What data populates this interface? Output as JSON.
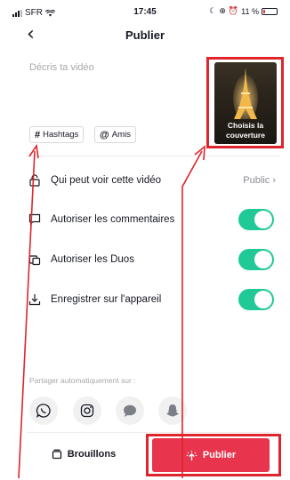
{
  "status_bar": {
    "carrier": "SFR",
    "time": "17:45",
    "battery": "11 %"
  },
  "header": {
    "title": "Publier"
  },
  "description": {
    "placeholder": "Décris ta vidéo"
  },
  "cover": {
    "label": "Choisis la couverture"
  },
  "chips": {
    "hashtags": "Hashtags",
    "friends": "Amis"
  },
  "settings": {
    "visibility": {
      "label": "Qui peut voir cette vidéo",
      "value": "Public"
    },
    "comments": {
      "label": "Autoriser les commentaires",
      "enabled": true
    },
    "duets": {
      "label": "Autoriser les Duos",
      "enabled": true
    },
    "save": {
      "label": "Enregistrer sur l'appareil",
      "enabled": true
    }
  },
  "share": {
    "label": "Partager automatiquement sur :",
    "icons": [
      "whatsapp-icon",
      "instagram-icon",
      "messages-icon",
      "snapchat-icon"
    ]
  },
  "footer": {
    "drafts_label": "Brouillons",
    "publish_label": "Publier"
  },
  "colors": {
    "accent": "#e8344d",
    "toggle_on": "#20c997",
    "annotation": "#e0242b"
  }
}
